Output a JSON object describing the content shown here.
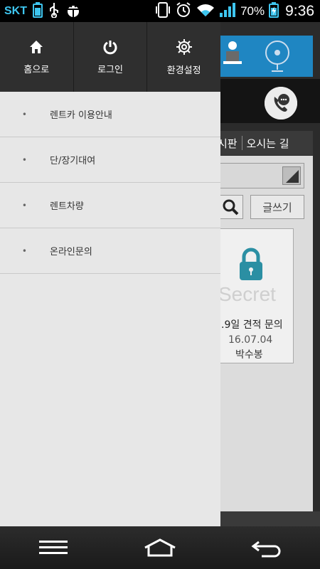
{
  "statusbar": {
    "carrier": "SKT",
    "battery_percent": "70%",
    "time": "9:36"
  },
  "drawer": {
    "top_buttons": [
      {
        "label": "홈으로",
        "icon": "home-icon"
      },
      {
        "label": "로그인",
        "icon": "power-icon"
      },
      {
        "label": "환경설정",
        "icon": "gear-icon"
      }
    ],
    "menu": [
      {
        "bullet": "•",
        "label": "렌트카 이용안내"
      },
      {
        "bullet": "•",
        "label": "단/장기대여"
      },
      {
        "bullet": "•",
        "label": "렌트차량"
      },
      {
        "bullet": "•",
        "label": "온라인문의"
      }
    ]
  },
  "background_page": {
    "nav": [
      "시판",
      "오시는 길"
    ],
    "write_button": "글쓰기",
    "card": {
      "lock_text": "Secret",
      "title": ".9일 견적 문의",
      "date": "16.07.04",
      "author": "박수봉"
    }
  },
  "colors": {
    "drawer_bg": "#e7e7e7",
    "drawer_header": "#2f2f2f",
    "carrier": "#3ec6f0",
    "banner": "#1f86c2"
  }
}
